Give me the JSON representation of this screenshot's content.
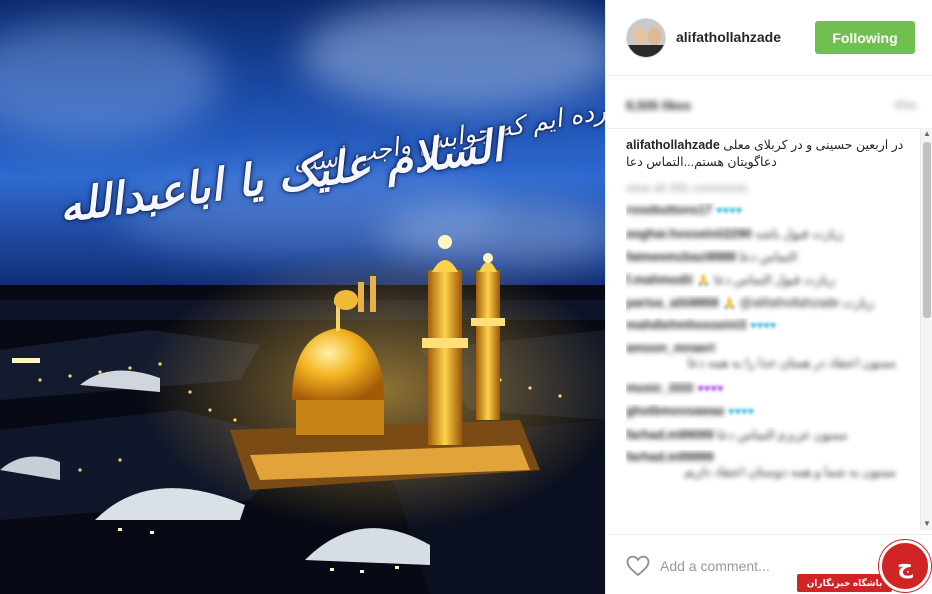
{
  "post": {
    "calligraphy_line1": "بر سختی دخوش کرده ایم که جوابش واجب است",
    "calligraphy_line2": "السلام علیک یا اباعبدالله",
    "image_icon": "shrine-photo"
  },
  "header": {
    "username": "alifathollahzade",
    "follow_label": "Following",
    "follow_color": "#70c050"
  },
  "stats": {
    "likes": "8,505 likes",
    "age": "40w"
  },
  "caption": {
    "username": "alifathollahzade",
    "text": "در اربعین حسینی و در کربلای معلی دعاگویتان هستم...التماس دعا"
  },
  "view_all_label": "view all 265 comments",
  "comments": [
    {
      "user": "rosebuttons17",
      "text": "",
      "emoji": "♥♥♥♥",
      "emoji_color": "cyan"
    },
    {
      "user": "asghar.hosseinii2290",
      "text": "زیارت قبول باشه",
      "emoji": ""
    },
    {
      "user": "fatmeemzbazi8988",
      "text": "التماس دعا",
      "emoji": ""
    },
    {
      "user": "f.mahmodii",
      "text": "زیارت قبول التماس دعا",
      "emoji": "🙏"
    },
    {
      "user": "parisa_aliii8858",
      "text": "@alifathollahzade زیارت",
      "emoji": "🙏"
    },
    {
      "user": "mahdiehmhosseini3",
      "text": "",
      "emoji": "♥♥♥♥",
      "emoji_color": "cyan"
    },
    {
      "user": "amoon_mnaeri",
      "text": "ممنون اعتقاد در همتان خدا را به همه دعا",
      "emoji": "",
      "tall": true
    },
    {
      "user": "music_iiiiiii",
      "text": "",
      "emoji": "♥♥♥♥",
      "emoji_color": "purple"
    },
    {
      "user": "ghotbmovsawaa",
      "text": "",
      "emoji": "♥♥♥♥",
      "emoji_color": "cyan"
    },
    {
      "user": "farhad.m99099",
      "text": "ممنون عزیزم التماس دعا",
      "emoji": ""
    },
    {
      "user": "farhad.m99999",
      "text": "ممنون به شما و همه دوستان اعتقاد داریم",
      "emoji": "",
      "tall": true
    }
  ],
  "footer": {
    "add_comment_placeholder": "Add a comment..."
  },
  "watermark": {
    "label": "باشگاه خبرنگاران",
    "glyph": "ج",
    "color": "#d02424"
  }
}
